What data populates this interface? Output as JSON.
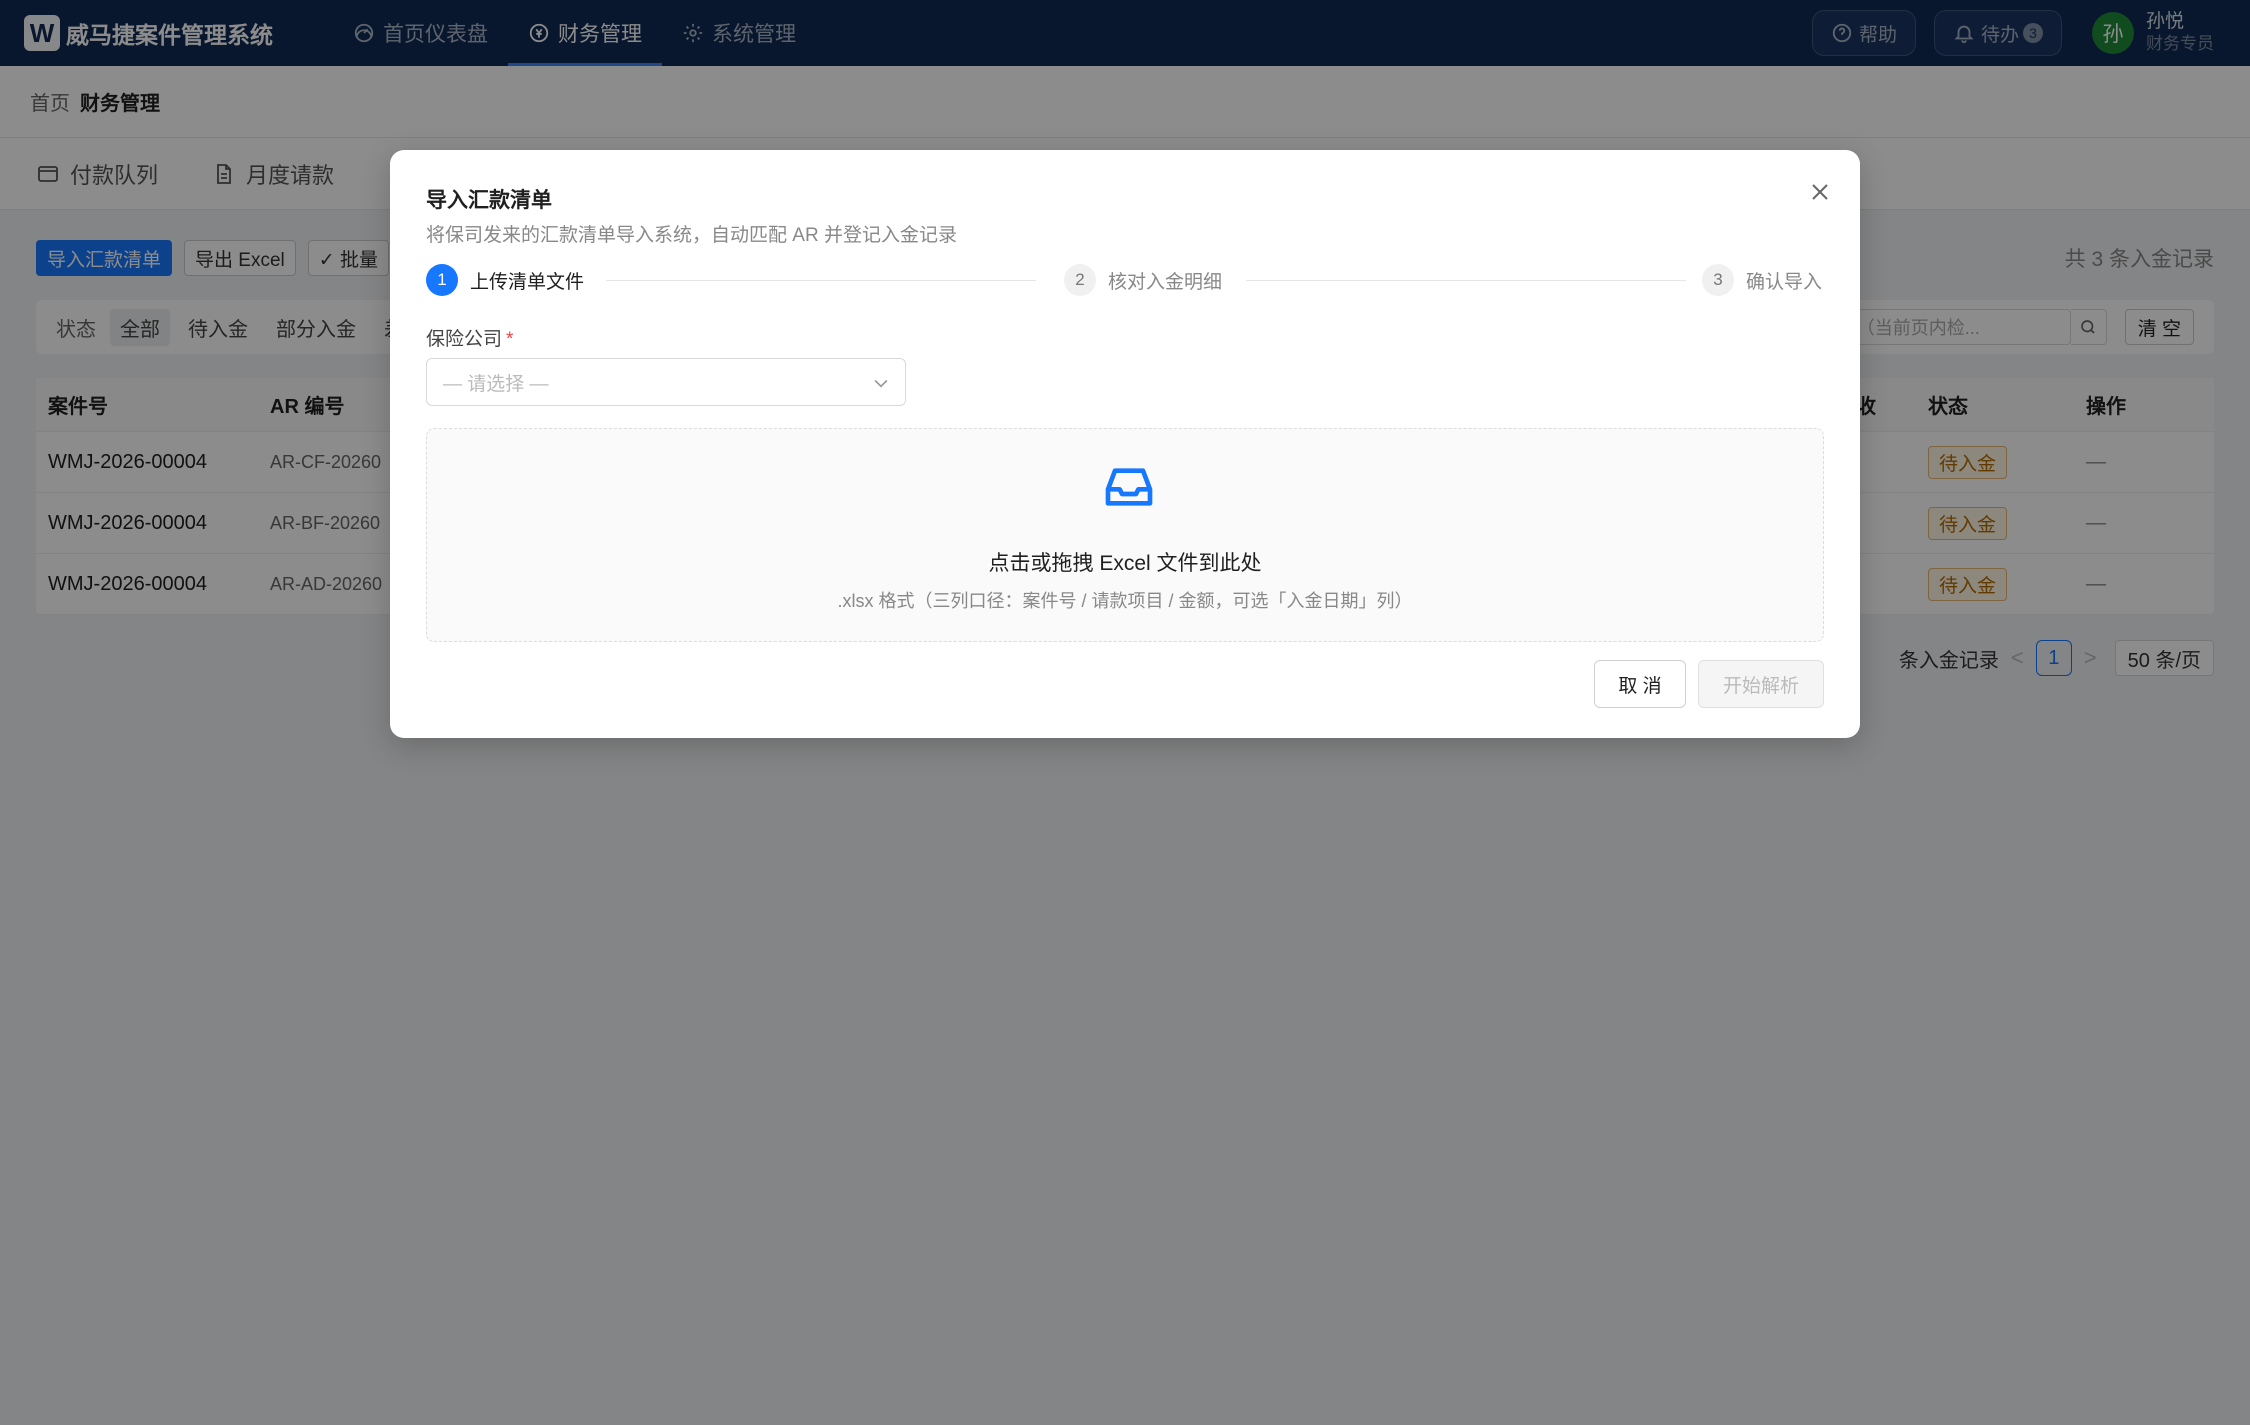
{
  "app": {
    "logo_letter": "W",
    "title": "威马捷案件管理系统"
  },
  "nav": {
    "items": [
      {
        "label": "首页仪表盘",
        "icon": "dashboard-icon"
      },
      {
        "label": "财务管理",
        "icon": "finance-icon",
        "active": true
      },
      {
        "label": "系统管理",
        "icon": "gear-icon"
      }
    ]
  },
  "topbar": {
    "help_label": "帮助",
    "todo_label": "待办",
    "todo_count": "3",
    "avatar_initial": "孙",
    "user_name": "孙悦",
    "user_role": "财务专员"
  },
  "breadcrumb": {
    "home": "首页",
    "current": "财务管理"
  },
  "tabs": [
    {
      "label": "付款队列",
      "icon": "wallet-icon"
    },
    {
      "label": "月度请款",
      "icon": "document-icon"
    }
  ],
  "toolbar": {
    "import_label": "导入汇款清单",
    "export_label": "导出 Excel",
    "batch_label": "✓ 批量",
    "count_text": "共 3 条入金记录"
  },
  "filter": {
    "label": "状态",
    "chips": [
      "全部",
      "待入金",
      "部分入金",
      "差异"
    ],
    "search_placeholder": "AR（当前页内检...",
    "clear_label": "清 空"
  },
  "table": {
    "headers": {
      "case_no": "案件号",
      "ar_no": "AR 编号",
      "paid": "收",
      "status": "状态",
      "op": "操作"
    },
    "rows": [
      {
        "case_no": "WMJ-2026-00004",
        "ar_no": "AR-CF-20260",
        "status": "待入金",
        "op": "—"
      },
      {
        "case_no": "WMJ-2026-00004",
        "ar_no": "AR-BF-20260",
        "status": "待入金",
        "op": "—"
      },
      {
        "case_no": "WMJ-2026-00004",
        "ar_no": "AR-AD-20260",
        "status": "待入金",
        "op": "—"
      }
    ]
  },
  "pager": {
    "text": "条入金记录",
    "prev": "<",
    "page": "1",
    "next": ">",
    "size": "50 条/页"
  },
  "modal": {
    "title": "导入汇款清单",
    "subtitle": "将保司发来的汇款清单导入系统，自动匹配 AR 并登记入金记录",
    "steps": [
      {
        "num": "1",
        "label": "上传清单文件",
        "active": true
      },
      {
        "num": "2",
        "label": "核对入金明细",
        "active": false
      },
      {
        "num": "3",
        "label": "确认导入",
        "active": false
      }
    ],
    "field_label": "保险公司",
    "required_mark": "*",
    "select_placeholder": "— 请选择 —",
    "upload_main": "点击或拖拽 Excel 文件到此处",
    "upload_hint": ".xlsx 格式（三列口径：案件号 / 请款项目 / 金额，可选「入金日期」列）",
    "cancel_label": "取 消",
    "start_label": "开始解析"
  },
  "colors": {
    "nav_bg": "#0f2a52",
    "primary": "#1677ff",
    "tag_text": "#b36b00"
  }
}
